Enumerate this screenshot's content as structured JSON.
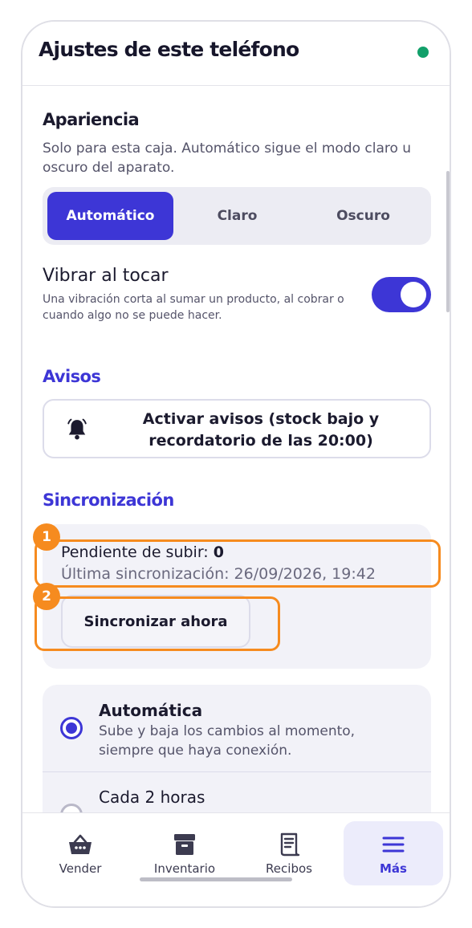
{
  "header": {
    "title": "Ajustes de este teléfono"
  },
  "appearance": {
    "title": "Apariencia",
    "description": "Solo para esta caja. Automático sigue el modo claro u oscuro del aparato.",
    "options": [
      "Automático",
      "Claro",
      "Oscuro"
    ],
    "selected": "Automático"
  },
  "vibration": {
    "label": "Vibrar al tocar",
    "help": "Una vibración corta al sumar un producto, al cobrar o cuando algo no se puede hacer.",
    "enabled": true
  },
  "notices": {
    "title": "Avisos",
    "button_line1": "Activar avisos (stock bajo y",
    "button_line2": "recordatorio de las 20:00)"
  },
  "sync": {
    "title": "Sincronización",
    "pending_label": "Pendiente de subir: ",
    "pending_value": "0",
    "last_sync": "Última sincronización: 26/09/2026, 19:42",
    "sync_now_label": "Sincronizar ahora",
    "options": [
      {
        "title": "Automática",
        "description": "Sube y baja los cambios al momento, siempre que haya conexión.",
        "selected": true
      },
      {
        "title": "Cada 2 horas",
        "description": "",
        "selected": false
      }
    ]
  },
  "callouts": [
    "1",
    "2"
  ],
  "bottom_nav": [
    {
      "label": "Vender",
      "icon": "basket-icon"
    },
    {
      "label": "Inventario",
      "icon": "archive-box-icon"
    },
    {
      "label": "Recibos",
      "icon": "receipt-icon"
    },
    {
      "label": "Más",
      "icon": "menu-icon",
      "active": true
    }
  ],
  "colors": {
    "accent": "#3d36d6",
    "callout": "#f68b1f",
    "status": "#12a06a"
  }
}
